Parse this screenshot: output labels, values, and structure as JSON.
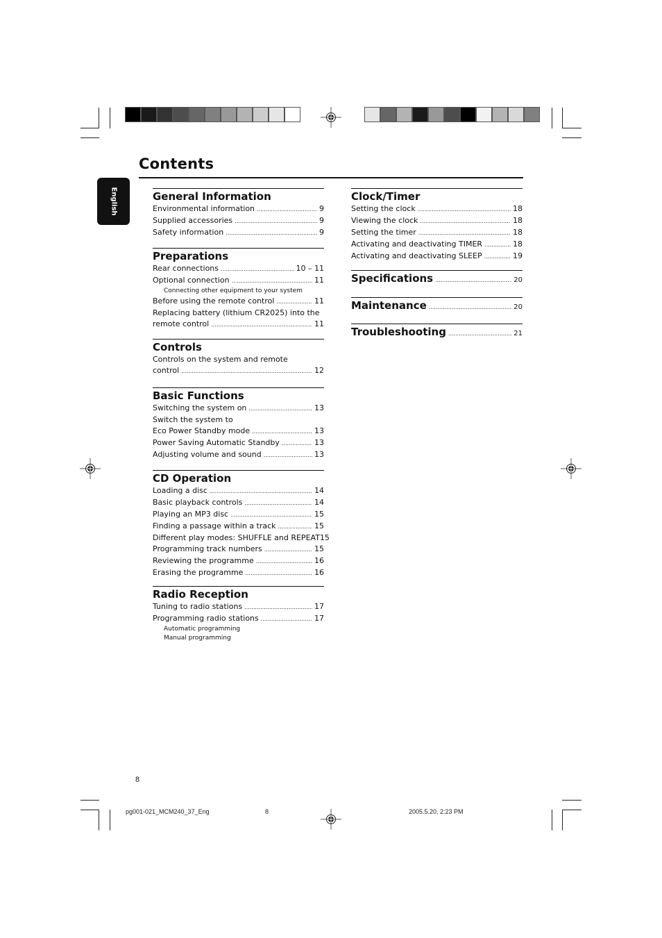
{
  "title": "Contents",
  "language_tab": "English",
  "colorbar_left": [
    "#000000",
    "#1a1a1a",
    "#333333",
    "#4d4d4d",
    "#666666",
    "#808080",
    "#999999",
    "#b3b3b3",
    "#cccccc",
    "#e6e6e6",
    "#ffffff"
  ],
  "colorbar_right": [
    "#e6e6e6",
    "#666666",
    "#b3b3b3",
    "#1a1a1a",
    "#999999",
    "#4d4d4d",
    "#000000",
    "#f2f2f2",
    "#b3b3b3",
    "#d9d9d9",
    "#808080"
  ],
  "left_column": [
    {
      "heading": "General Information",
      "entries": [
        {
          "text": "Environmental information",
          "page": "9"
        },
        {
          "text": "Supplied accessories",
          "page": "9"
        },
        {
          "text": "Safety information",
          "page": "9"
        }
      ]
    },
    {
      "heading": "Preparations",
      "entries": [
        {
          "text": "Rear connections",
          "page": "10 – 11"
        },
        {
          "text": "Optional connection",
          "page": "11"
        },
        {
          "text": "Connecting other equipment to your system",
          "sub": true
        },
        {
          "text": "Before using the remote control",
          "page": "11"
        },
        {
          "text": "Replacing battery (lithium CR2025) into the",
          "nopage": true
        },
        {
          "text": "remote control",
          "page": "11"
        }
      ]
    },
    {
      "heading": "Controls",
      "entries": [
        {
          "text": "Controls on the system and remote",
          "nopage": true
        },
        {
          "text": "control",
          "page": "12"
        }
      ]
    },
    {
      "heading": "Basic Functions",
      "entries": [
        {
          "text": "Switching the system on",
          "page": "13"
        },
        {
          "text": "Switch the system to",
          "nopage": true
        },
        {
          "text": "Eco Power Standby mode",
          "page": "13"
        },
        {
          "text": "Power Saving Automatic Standby",
          "page": "13"
        },
        {
          "text": "Adjusting volume and sound",
          "page": "13"
        }
      ]
    },
    {
      "heading": "CD Operation",
      "entries": [
        {
          "text": "Loading a disc",
          "page": "14"
        },
        {
          "text": "Basic playback controls",
          "page": "14"
        },
        {
          "text": "Playing an MP3 disc",
          "page": "15"
        },
        {
          "text": "Finding a passage within a track",
          "page": "15"
        },
        {
          "text": "Different play modes: SHUFFLE and REPEAT",
          "page": "15",
          "nodots": true
        },
        {
          "text": "Programming track numbers",
          "page": "15"
        },
        {
          "text": "Reviewing the programme",
          "page": "16"
        },
        {
          "text": "Erasing the programme",
          "page": "16"
        }
      ]
    },
    {
      "heading": "Radio Reception",
      "entries": [
        {
          "text": "Tuning to radio stations",
          "page": "17"
        },
        {
          "text": "Programming radio stations",
          "page": "17"
        },
        {
          "text": "Automatic programming",
          "sub": true
        },
        {
          "text": "Manual programming",
          "sub": true
        }
      ]
    }
  ],
  "right_column": [
    {
      "heading": "Clock/Timer",
      "entries": [
        {
          "text": "Setting the clock",
          "page": "18"
        },
        {
          "text": "Viewing the clock",
          "page": "18"
        },
        {
          "text": "Setting the timer",
          "page": "18"
        },
        {
          "text": "Activating and deactivating TIMER",
          "page": "18"
        },
        {
          "text": "Activating and deactivating SLEEP",
          "page": "19"
        }
      ]
    },
    {
      "heading": "Specifications",
      "page": "20"
    },
    {
      "heading": "Maintenance",
      "page": "20"
    },
    {
      "heading": "Troubleshooting",
      "page": "21"
    }
  ],
  "page_number": "8",
  "footer": {
    "file": "pg001-021_MCM240_37_Eng",
    "page": "8",
    "timestamp": "2005.5.20, 2:23 PM"
  }
}
